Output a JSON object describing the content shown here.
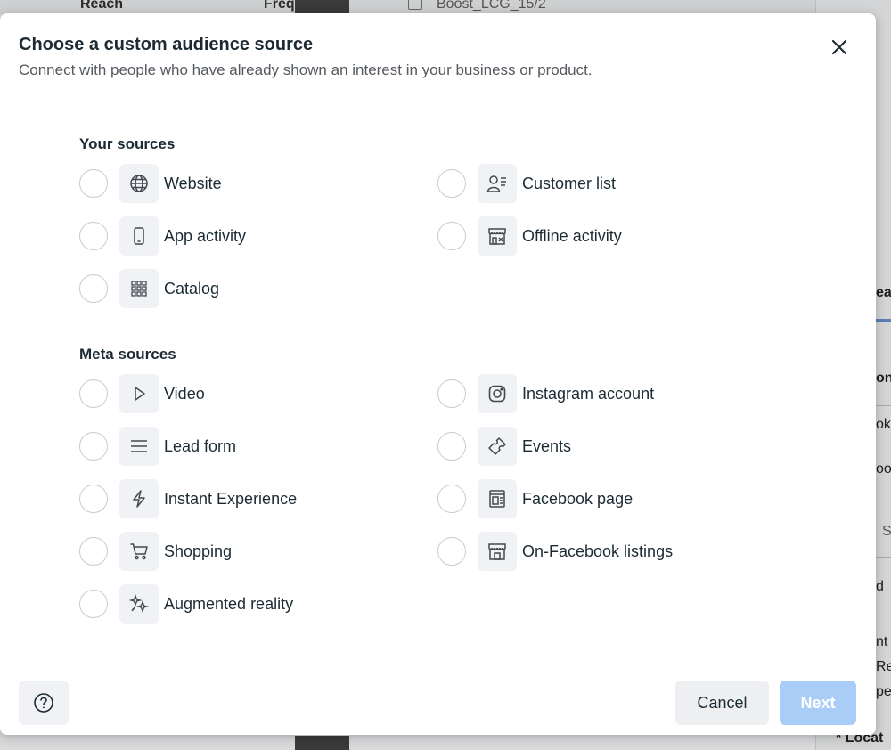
{
  "background": {
    "top_items": [
      "Reach",
      "Freq",
      "Boost_LCG_15/2"
    ],
    "right_fragments": [
      "ea",
      "on",
      "ok",
      "oo",
      "S",
      "d",
      "nt",
      "Re",
      "pe",
      "* Locat"
    ]
  },
  "modal": {
    "title": "Choose a custom audience source",
    "subtitle": "Connect with people who have already shown an interest in your business or product.",
    "close_icon": "close-icon"
  },
  "your_sources": {
    "title": "Your sources",
    "left": [
      {
        "label": "Website",
        "icon": "globe-icon"
      },
      {
        "label": "App activity",
        "icon": "mobile-phone-icon"
      },
      {
        "label": "Catalog",
        "icon": "grid-icon"
      }
    ],
    "right": [
      {
        "label": "Customer list",
        "icon": "contact-list-icon"
      },
      {
        "label": "Offline activity",
        "icon": "store-icon"
      }
    ]
  },
  "meta_sources": {
    "title": "Meta sources",
    "left": [
      {
        "label": "Video",
        "icon": "play-icon"
      },
      {
        "label": "Lead form",
        "icon": "lines-icon"
      },
      {
        "label": "Instant Experience",
        "icon": "lightning-icon"
      },
      {
        "label": "Shopping",
        "icon": "cart-icon"
      },
      {
        "label": "Augmented reality",
        "icon": "sparkle-icon"
      }
    ],
    "right": [
      {
        "label": "Instagram account",
        "icon": "instagram-icon"
      },
      {
        "label": "Events",
        "icon": "ticket-icon"
      },
      {
        "label": "Facebook page",
        "icon": "page-icon"
      },
      {
        "label": "On-Facebook listings",
        "icon": "shop-icon"
      }
    ]
  },
  "footer": {
    "help_icon": "help-icon",
    "cancel_label": "Cancel",
    "next_label": "Next"
  },
  "colors": {
    "title_text": "#1c2b33",
    "icon_bg": "#f0f2f5",
    "next_disabled": "#a9cdf6",
    "overlay": "#8a8a8a"
  }
}
